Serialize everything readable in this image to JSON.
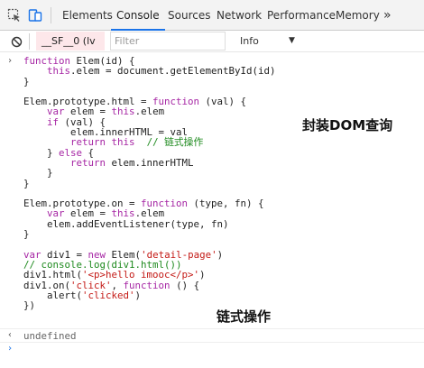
{
  "toolbar": {
    "inspect_icon": "element-picker-icon",
    "device_icon": "device-toolbar-icon",
    "tabs": [
      {
        "label": "Elements",
        "active": false
      },
      {
        "label": "Console",
        "active": true
      },
      {
        "label": "Sources",
        "active": false
      },
      {
        "label": "Network",
        "active": false
      },
      {
        "label": "Performance",
        "active": false
      },
      {
        "label": "Memory",
        "active": false
      }
    ],
    "more_label": "»"
  },
  "filterbar": {
    "clear_icon": "no-entry-icon",
    "context_label": "__SF__0 (lv",
    "filter_placeholder": "Filter",
    "level_label": "Info",
    "level_arrow": "▼"
  },
  "console": {
    "input_prompt": "›",
    "code_lines": [
      [
        {
          "t": "function",
          "c": "k"
        },
        {
          "t": " Elem(id) {"
        }
      ],
      [
        {
          "t": "    "
        },
        {
          "t": "this",
          "c": "k"
        },
        {
          "t": ".elem = document.getElementById(id)"
        }
      ],
      [
        {
          "t": "}"
        }
      ],
      [
        {
          "t": ""
        }
      ],
      [
        {
          "t": "Elem.prototype.html = "
        },
        {
          "t": "function",
          "c": "k"
        },
        {
          "t": " (val) {"
        }
      ],
      [
        {
          "t": "    "
        },
        {
          "t": "var",
          "c": "k"
        },
        {
          "t": " elem = "
        },
        {
          "t": "this",
          "c": "k"
        },
        {
          "t": ".elem"
        }
      ],
      [
        {
          "t": "    "
        },
        {
          "t": "if",
          "c": "k"
        },
        {
          "t": " (val) {"
        }
      ],
      [
        {
          "t": "        elem.innerHTML = val"
        }
      ],
      [
        {
          "t": "        "
        },
        {
          "t": "return",
          "c": "k"
        },
        {
          "t": " "
        },
        {
          "t": "this",
          "c": "k"
        },
        {
          "t": "  "
        },
        {
          "t": "// 链式操作",
          "c": "c"
        }
      ],
      [
        {
          "t": "    } "
        },
        {
          "t": "else",
          "c": "k"
        },
        {
          "t": " {"
        }
      ],
      [
        {
          "t": "        "
        },
        {
          "t": "return",
          "c": "k"
        },
        {
          "t": " elem.innerHTML"
        }
      ],
      [
        {
          "t": "    }"
        }
      ],
      [
        {
          "t": "}"
        }
      ],
      [
        {
          "t": ""
        }
      ],
      [
        {
          "t": "Elem.prototype.on = "
        },
        {
          "t": "function",
          "c": "k"
        },
        {
          "t": " (type, fn) {"
        }
      ],
      [
        {
          "t": "    "
        },
        {
          "t": "var",
          "c": "k"
        },
        {
          "t": " elem = "
        },
        {
          "t": "this",
          "c": "k"
        },
        {
          "t": ".elem"
        }
      ],
      [
        {
          "t": "    elem.addEventListener(type, fn)"
        }
      ],
      [
        {
          "t": "}"
        }
      ],
      [
        {
          "t": ""
        }
      ],
      [
        {
          "t": "var",
          "c": "k"
        },
        {
          "t": " div1 = "
        },
        {
          "t": "new",
          "c": "k"
        },
        {
          "t": " Elem("
        },
        {
          "t": "'detail-page'",
          "c": "s"
        },
        {
          "t": ")"
        }
      ],
      [
        {
          "t": "// console.log(div1.html())",
          "c": "c"
        }
      ],
      [
        {
          "t": "div1.html("
        },
        {
          "t": "'<p>hello imooc</p>'",
          "c": "s"
        },
        {
          "t": ")"
        }
      ],
      [
        {
          "t": "div1.on("
        },
        {
          "t": "'click'",
          "c": "s"
        },
        {
          "t": ", "
        },
        {
          "t": "function",
          "c": "k"
        },
        {
          "t": " () {"
        }
      ],
      [
        {
          "t": "    alert("
        },
        {
          "t": "'clicked'",
          "c": "s"
        },
        {
          "t": ")"
        }
      ],
      [
        {
          "t": "})"
        }
      ]
    ],
    "result_prompt": "‹",
    "result_text": "undefined",
    "new_prompt": "›"
  },
  "annotations": {
    "dom_wrap": "封装DOM查询",
    "chain_ops": "链式操作"
  }
}
